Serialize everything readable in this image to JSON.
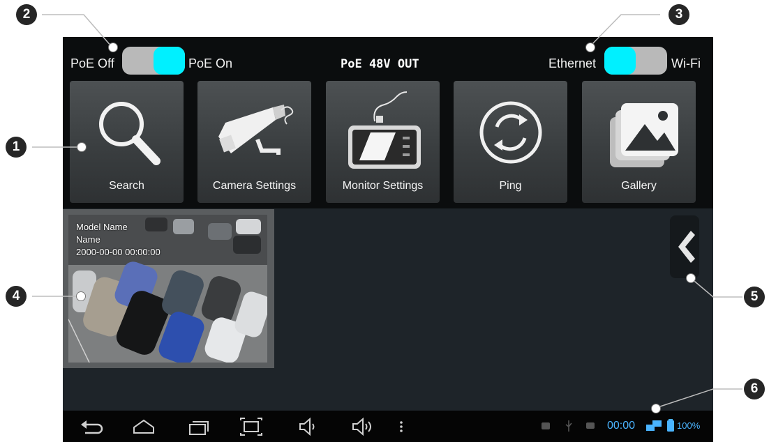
{
  "topbar": {
    "poe_off_label": "PoE Off",
    "poe_on_label": "PoE On",
    "status_title": "PoE 48V OUT",
    "ethernet_label": "Ethernet",
    "wifi_label": "Wi-Fi"
  },
  "tiles": [
    {
      "label": "Search",
      "icon": "search-icon"
    },
    {
      "label": "Camera Settings",
      "icon": "camera-icon"
    },
    {
      "label": "Monitor Settings",
      "icon": "monitor-icon"
    },
    {
      "label": "Ping",
      "icon": "refresh-icon"
    },
    {
      "label": "Gallery",
      "icon": "gallery-icon"
    }
  ],
  "preview": {
    "model_name": "Model Name",
    "name": "Name",
    "timestamp": "2000-00-00 00:00:00"
  },
  "statusbar": {
    "time": "00:00",
    "battery": "100%"
  },
  "callouts": [
    "1",
    "2",
    "3",
    "4",
    "5",
    "6"
  ],
  "colors": {
    "accent_toggle": "#00f0ff",
    "status_text": "#4ab4ff"
  }
}
